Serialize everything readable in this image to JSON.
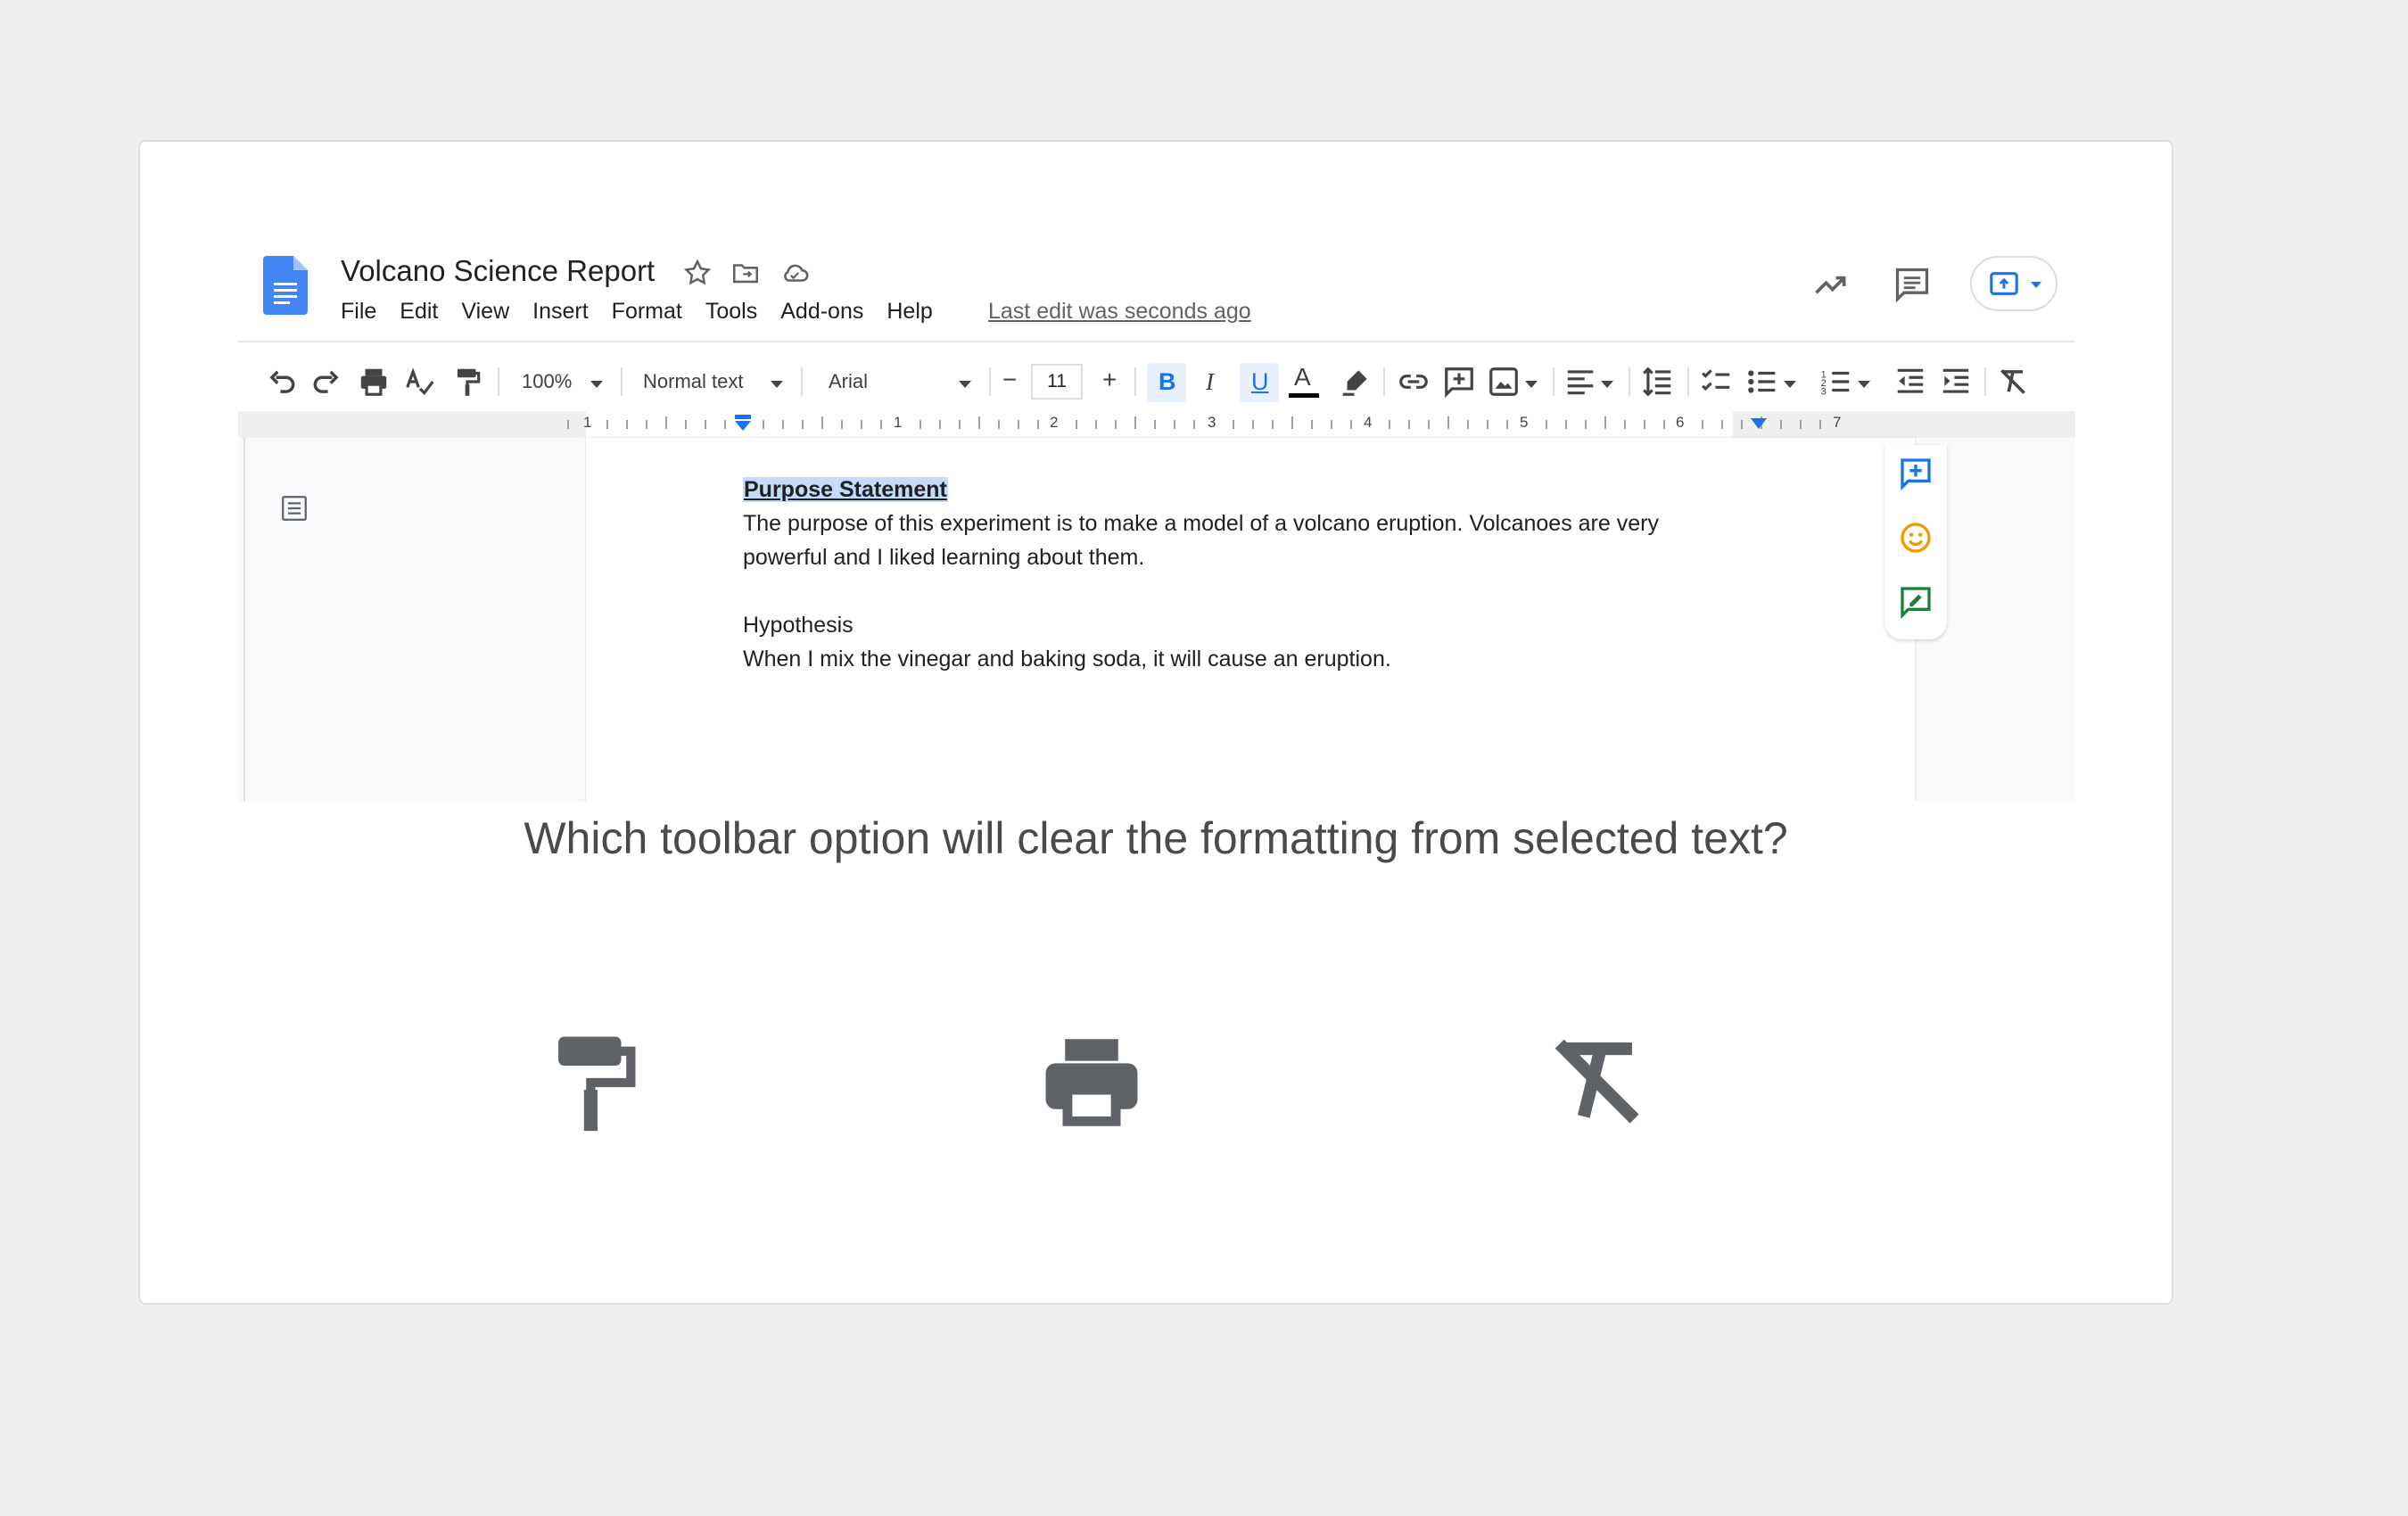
{
  "doc": {
    "title": "Volcano Science Report",
    "menu": [
      "File",
      "Edit",
      "View",
      "Insert",
      "Format",
      "Tools",
      "Add-ons",
      "Help"
    ],
    "last_edit": "Last edit was seconds ago"
  },
  "toolbar": {
    "zoom": "100%",
    "style": "Normal text",
    "font": "Arial",
    "font_size": "11",
    "minus": "−",
    "plus": "+",
    "bold": "B",
    "italic": "I",
    "underline": "U",
    "text_color": "A"
  },
  "ruler": {
    "numbers": [
      "1",
      "1",
      "2",
      "3",
      "4",
      "5",
      "6",
      "7"
    ]
  },
  "page": {
    "heading": "Purpose Statement",
    "para1_line1": "The purpose of this experiment is to make a model of a volcano eruption. Volcanoes are very",
    "para1_line2": "powerful and I liked learning about them.",
    "hypothesis_label": "Hypothesis",
    "hypothesis_text": "When I mix the vinegar and baking soda, it will cause an eruption."
  },
  "question": "Which toolbar option will clear the formatting from selected text?",
  "options": [
    {
      "icon": "paint-format-icon"
    },
    {
      "icon": "print-icon"
    },
    {
      "icon": "clear-formatting-icon"
    }
  ],
  "colors": {
    "accent": "#1a73e8",
    "docs_blue": "#4285f4",
    "selection": "#c6dafc",
    "emoji_yellow": "#f29900",
    "suggest_green": "#188038"
  }
}
